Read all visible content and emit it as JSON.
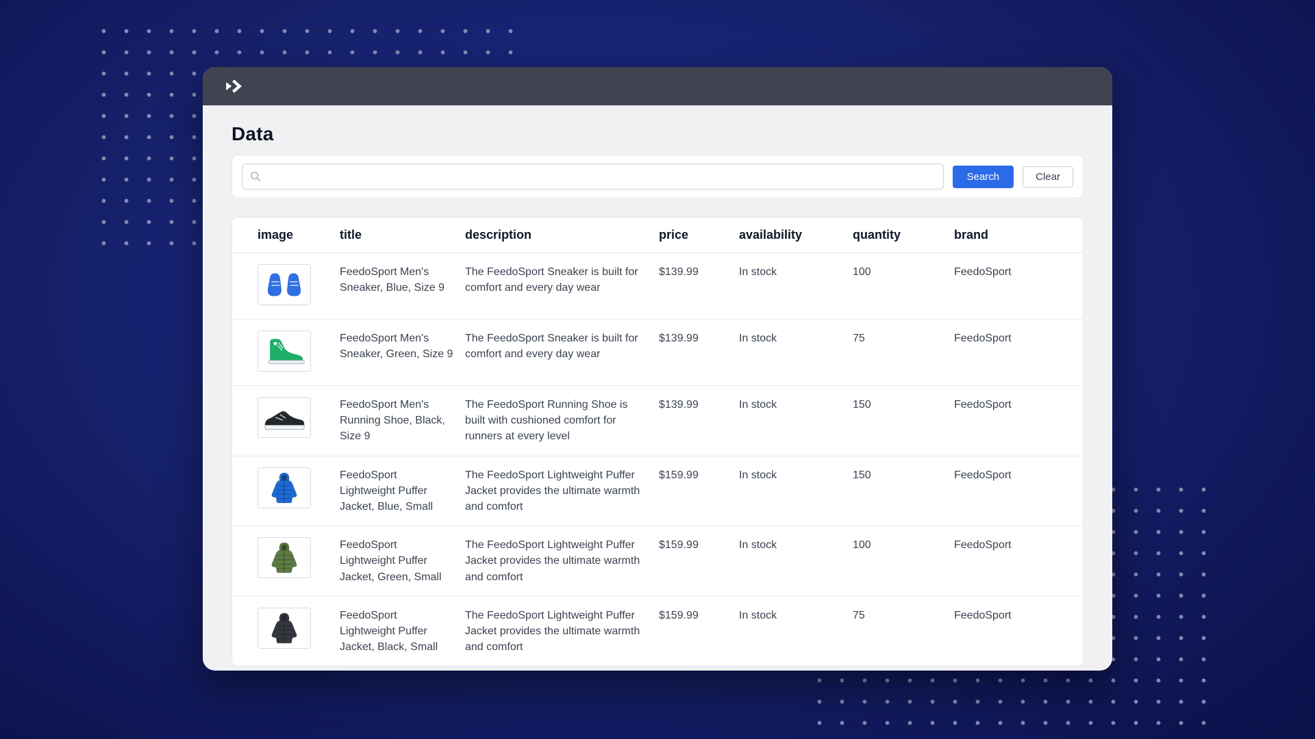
{
  "app": {
    "logo": "double-chevron-logo"
  },
  "page": {
    "title": "Data"
  },
  "search": {
    "value": "",
    "placeholder": "",
    "search_label": "Search",
    "clear_label": "Clear"
  },
  "colors": {
    "accent_blue": "#2b6be8",
    "header_bar": "#3f4450",
    "background_navy": "#152069"
  },
  "table": {
    "columns": [
      "image",
      "title",
      "description",
      "price",
      "availability",
      "quantity",
      "brand"
    ],
    "rows": [
      {
        "image": {
          "kind": "sneaker-pair",
          "color": "#2e6fe3",
          "name": "blue-sneaker-image"
        },
        "title": "FeedoSport Men's Sneaker, Blue, Size 9",
        "description": "The FeedoSport Sneaker is built for comfort and every day wear",
        "price": "$139.99",
        "availability": "In stock",
        "quantity": "100",
        "brand": "FeedoSport"
      },
      {
        "image": {
          "kind": "sneaker-high",
          "color": "#1fae6a",
          "name": "green-sneaker-image"
        },
        "title": "FeedoSport Men's Sneaker, Green, Size 9",
        "description": "The FeedoSport Sneaker is built for comfort and every day wear",
        "price": "$139.99",
        "availability": "In stock",
        "quantity": "75",
        "brand": "FeedoSport"
      },
      {
        "image": {
          "kind": "running-shoe",
          "color": "#23272e",
          "name": "black-running-shoe-image"
        },
        "title": "FeedoSport Men's Running Shoe, Black, Size 9",
        "description": "The FeedoSport Running Shoe is built with cushioned comfort for runners at every level",
        "price": "$139.99",
        "availability": "In stock",
        "quantity": "150",
        "brand": "FeedoSport"
      },
      {
        "image": {
          "kind": "puffer-jacket",
          "color": "#1e6bd7",
          "name": "blue-puffer-jacket-image"
        },
        "title": "FeedoSport Lightweight Puffer Jacket, Blue, Small",
        "description": "The FeedoSport Lightweight Puffer Jacket provides the ultimate warmth and comfort",
        "price": "$159.99",
        "availability": "In stock",
        "quantity": "150",
        "brand": "FeedoSport"
      },
      {
        "image": {
          "kind": "puffer-jacket",
          "color": "#5d7c42",
          "name": "green-puffer-jacket-image"
        },
        "title": "FeedoSport Lightweight Puffer Jacket, Green, Small",
        "description": "The FeedoSport Lightweight Puffer Jacket provides the ultimate warmth and comfort",
        "price": "$159.99",
        "availability": "In stock",
        "quantity": "100",
        "brand": "FeedoSport"
      },
      {
        "image": {
          "kind": "puffer-jacket",
          "color": "#34383f",
          "name": "black-puffer-jacket-image"
        },
        "title": "FeedoSport Lightweight Puffer Jacket, Black, Small",
        "description": "The FeedoSport Lightweight Puffer Jacket provides the ultimate warmth and comfort",
        "price": "$159.99",
        "availability": "In stock",
        "quantity": "75",
        "brand": "FeedoSport"
      }
    ]
  }
}
